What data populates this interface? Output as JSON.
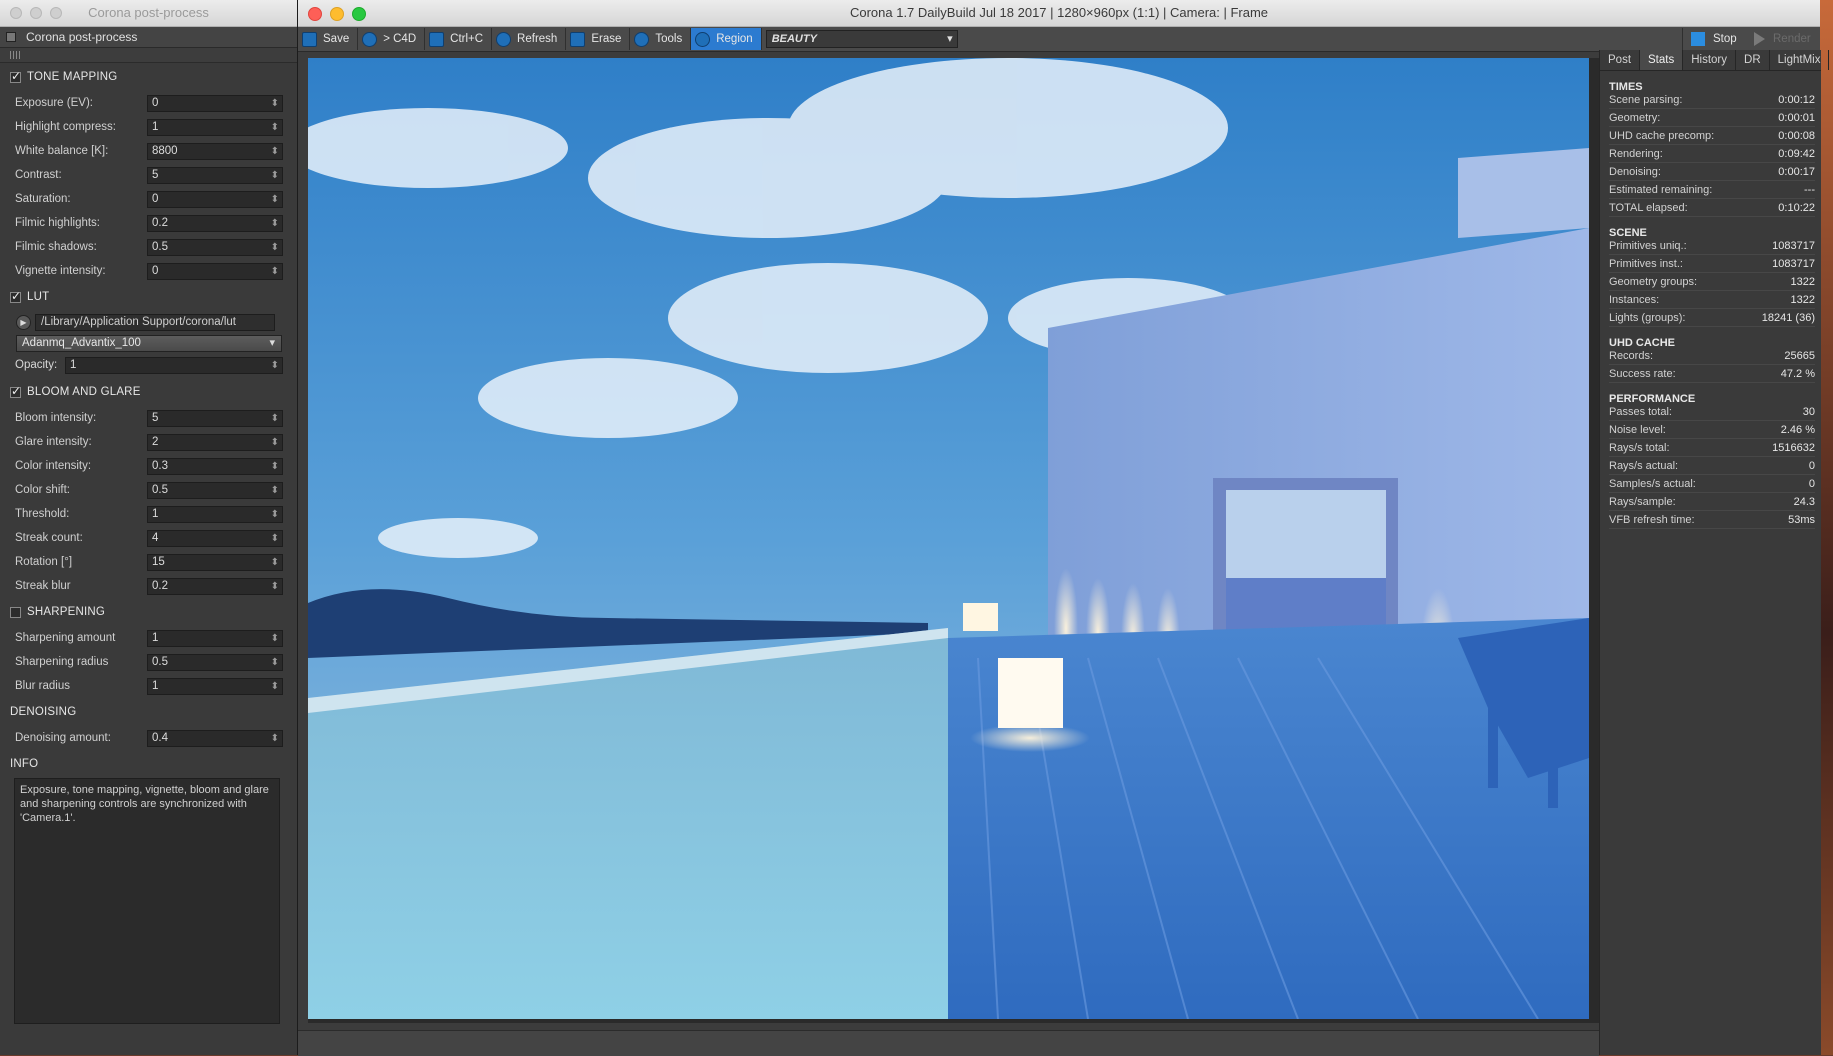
{
  "post_window": {
    "title": "Corona post-process",
    "subtitle": "Corona post-process",
    "tone_mapping": {
      "header": "TONE MAPPING",
      "rows": [
        {
          "label": "Exposure (EV):",
          "value": "0"
        },
        {
          "label": "Highlight compress:",
          "value": "1"
        },
        {
          "label": "White balance [K]:",
          "value": "8800"
        },
        {
          "label": "Contrast:",
          "value": "5"
        },
        {
          "label": "Saturation:",
          "value": "0"
        },
        {
          "label": "Filmic highlights:",
          "value": "0.2"
        },
        {
          "label": "Filmic shadows:",
          "value": "0.5"
        },
        {
          "label": "Vignette intensity:",
          "value": "0"
        }
      ]
    },
    "lut": {
      "header": "LUT",
      "path": "/Library/Application Support/corona/lut",
      "selected": "Adanmq_Advantix_100",
      "opacity_label": "Opacity:",
      "opacity_value": "1"
    },
    "bloom": {
      "header": "BLOOM AND GLARE",
      "rows": [
        {
          "label": "Bloom intensity:",
          "value": "5"
        },
        {
          "label": "Glare intensity:",
          "value": "2"
        },
        {
          "label": "Color intensity:",
          "value": "0.3"
        },
        {
          "label": "Color shift:",
          "value": "0.5"
        },
        {
          "label": "Threshold:",
          "value": "1"
        },
        {
          "label": "Streak count:",
          "value": "4"
        },
        {
          "label": "Rotation [°]",
          "value": "15"
        },
        {
          "label": "Streak blur",
          "value": "0.2"
        }
      ]
    },
    "sharpening": {
      "header": "SHARPENING",
      "rows": [
        {
          "label": "Sharpening amount",
          "value": "1"
        },
        {
          "label": "Sharpening radius",
          "value": "0.5"
        },
        {
          "label": "Blur radius",
          "value": "1"
        }
      ]
    },
    "denoising": {
      "header": "DENOISING",
      "label": "Denoising amount:",
      "value": "0.4"
    },
    "info": {
      "header": "INFO",
      "text": "Exposure, tone mapping, vignette, bloom and glare and sharpening controls are synchronized with 'Camera.1'."
    }
  },
  "vfb": {
    "title": "Corona 1.7 DailyBuild Jul 18 2017 | 1280×960px (1:1) | Camera:  | Frame",
    "toolbar": {
      "save": "Save",
      "c4d": "> C4D",
      "ctrlc": "Ctrl+C",
      "refresh": "Refresh",
      "erase": "Erase",
      "tools": "Tools",
      "region": "Region",
      "channel": "BEAUTY",
      "stop": "Stop",
      "render": "Render"
    },
    "tabs": [
      "Post",
      "Stats",
      "History",
      "DR",
      "LightMix"
    ],
    "stats": {
      "times": {
        "header": "TIMES",
        "rows": [
          [
            "Scene parsing:",
            "0:00:12"
          ],
          [
            "Geometry:",
            "0:00:01"
          ],
          [
            "UHD cache precomp:",
            "0:00:08"
          ],
          [
            "Rendering:",
            "0:09:42"
          ],
          [
            "Denoising:",
            "0:00:17"
          ],
          [
            "Estimated remaining:",
            "---"
          ],
          [
            "TOTAL elapsed:",
            "0:10:22"
          ]
        ]
      },
      "scene": {
        "header": "SCENE",
        "rows": [
          [
            "Primitives uniq.:",
            "1083717"
          ],
          [
            "Primitives inst.:",
            "1083717"
          ],
          [
            "Geometry groups:",
            "1322"
          ],
          [
            "Instances:",
            "1322"
          ],
          [
            "Lights (groups):",
            "18241 (36)"
          ]
        ]
      },
      "uhd": {
        "header": "UHD CACHE",
        "rows": [
          [
            "Records:",
            "25665"
          ],
          [
            "Success rate:",
            "47.2 %"
          ]
        ]
      },
      "performance": {
        "header": "PERFORMANCE",
        "rows": [
          [
            "Passes total:",
            "30"
          ],
          [
            "Noise level:",
            "2.46 %"
          ],
          [
            "Rays/s total:",
            "1516632"
          ],
          [
            "Rays/s actual:",
            "0"
          ],
          [
            "Samples/s actual:",
            "0"
          ],
          [
            "Rays/sample:",
            "24.3"
          ],
          [
            "VFB refresh time:",
            "53ms"
          ]
        ]
      }
    }
  }
}
